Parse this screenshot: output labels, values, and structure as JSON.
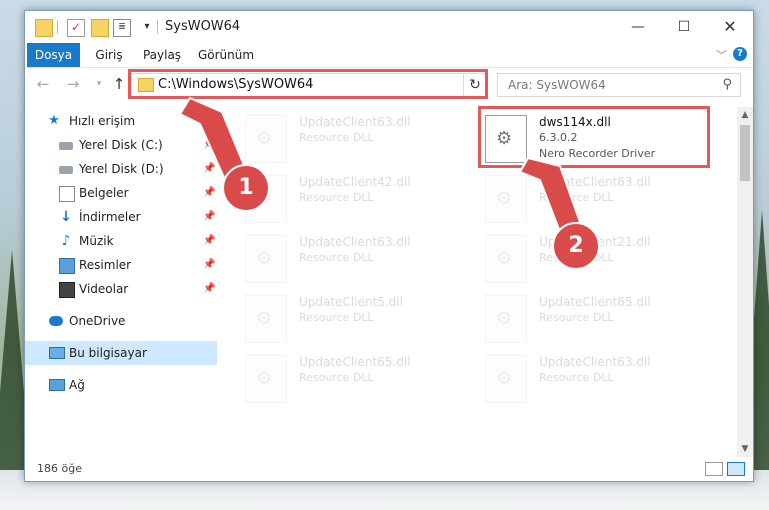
{
  "window": {
    "title": "SysWOW64",
    "minimize": "—",
    "maximize": "☐",
    "close": "✕"
  },
  "quick_access_toolbar": {
    "check_glyph": "✓",
    "props_glyph": "≣",
    "dropdown_glyph": "▾"
  },
  "ribbon": {
    "tabs": [
      {
        "label": "Dosya",
        "active": true
      },
      {
        "label": "Giriş"
      },
      {
        "label": "Paylaş"
      },
      {
        "label": "Görünüm"
      }
    ],
    "expand_glyph": "﹀",
    "help_glyph": "?"
  },
  "navigation": {
    "back": "←",
    "forward": "→",
    "recent": "▾",
    "up": "↑",
    "address": "C:\\Windows\\SysWOW64",
    "address_dropdown": "⌄",
    "refresh": "↻",
    "search_placeholder": "Ara: SysWOW64",
    "search_glyph": "⚲"
  },
  "sidebar": {
    "items": [
      {
        "label": "Hızlı erişim",
        "icon": "star-icon",
        "glyph": "★"
      },
      {
        "label": "Yerel Disk (C:)",
        "icon": "disk-icon",
        "pinned": true
      },
      {
        "label": "Yerel Disk (D:)",
        "icon": "disk-icon",
        "pinned": true
      },
      {
        "label": "Belgeler",
        "icon": "documents-icon",
        "pinned": true
      },
      {
        "label": "İndirmeler",
        "icon": "download-icon",
        "glyph": "↓",
        "pinned": true
      },
      {
        "label": "Müzik",
        "icon": "music-icon",
        "glyph": "♪",
        "pinned": true
      },
      {
        "label": "Resimler",
        "icon": "pictures-icon",
        "pinned": true
      },
      {
        "label": "Videolar",
        "icon": "videos-icon",
        "pinned": true
      },
      {
        "label": "OneDrive",
        "icon": "cloud-icon"
      },
      {
        "label": "Bu bilgisayar",
        "icon": "computer-icon",
        "selected": true
      },
      {
        "label": "Ağ",
        "icon": "network-icon"
      }
    ],
    "pin_glyph": "📌"
  },
  "files": [
    {
      "name": "UpdateClient63.dll",
      "desc": "Resource DLL"
    },
    {
      "name": "dws114x.dll",
      "version": "6.3.0.2",
      "desc": "Nero Recorder Driver",
      "highlighted": true
    },
    {
      "name": "UpdateClient42.dll",
      "desc": "Resource DLL"
    },
    {
      "name": "UpdateClient63.dll",
      "desc": "Resource DLL"
    },
    {
      "name": "UpdateClient63.dll",
      "desc": "Resource DLL"
    },
    {
      "name": "UpdateClient21.dll",
      "desc": "Resource DLL"
    },
    {
      "name": "UpdateClient5.dll",
      "desc": "Resource DLL"
    },
    {
      "name": "UpdateClient65.dll",
      "desc": "Resource DLL"
    },
    {
      "name": "UpdateClient65.dll",
      "desc": "Resource DLL"
    },
    {
      "name": "UpdateClient63.dll",
      "desc": "Resource DLL"
    }
  ],
  "scrollbar": {
    "up": "▲",
    "down": "▼"
  },
  "status": {
    "item_count": "186 öğe"
  },
  "callouts": [
    "1",
    "2"
  ],
  "colors": {
    "accent": "#1979ca",
    "callout": "#d94b4b",
    "highlight_box": "#e05a5a"
  }
}
